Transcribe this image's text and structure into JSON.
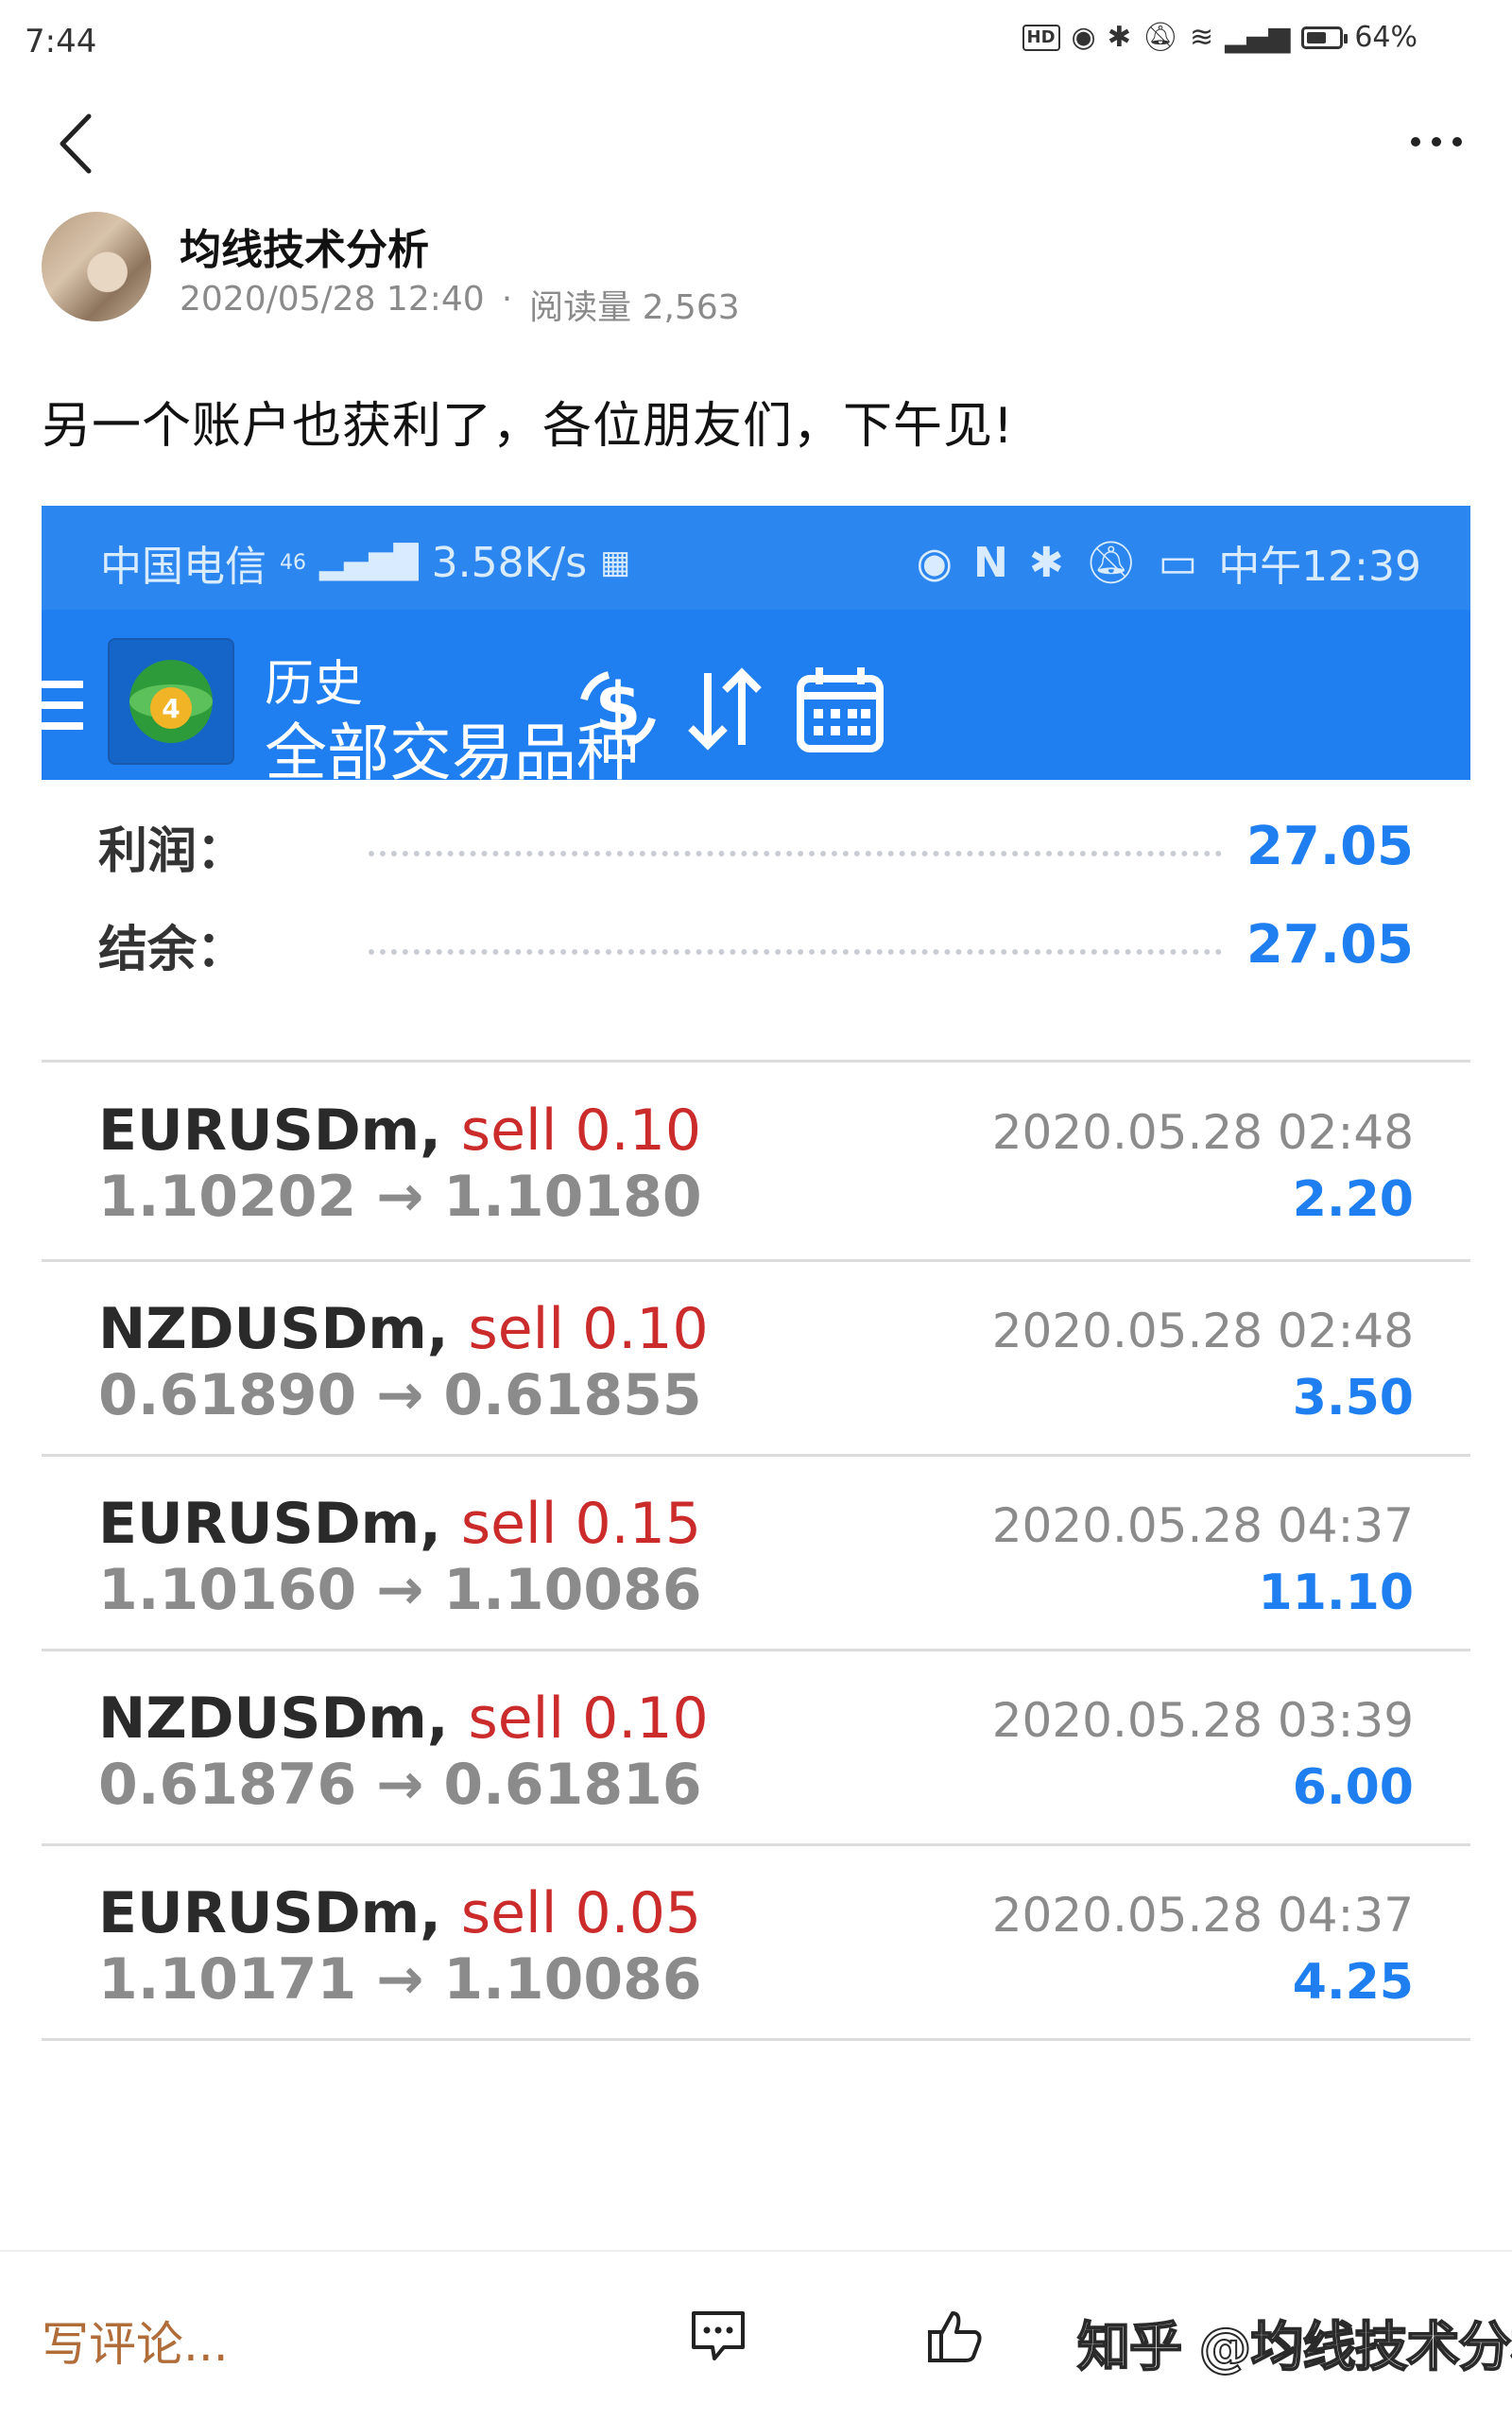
{
  "status_bar": {
    "time": "7:44",
    "hd": "HD",
    "battery": "64%",
    "battery_level": 0.64
  },
  "article": {
    "author": "均线技术分析",
    "date": "2020/05/28 12:40",
    "separator": "·",
    "views_label": "阅读量 2,563",
    "text": "另一个账户也获利了，各位朋友们，下午见!"
  },
  "embedded": {
    "status": {
      "carrier": "中国电信",
      "network": "46",
      "speed": "3.58K/s",
      "time": "中午12:39"
    },
    "appbar": {
      "title": "历史",
      "subtitle": "全部交易品种",
      "logo_number": "4"
    },
    "summary": [
      {
        "label": "利润：",
        "value": "27.05"
      },
      {
        "label": "结余：",
        "value": "27.05"
      }
    ],
    "trades": [
      {
        "symbol": "EURUSDm",
        "action": "sell 0.10",
        "open": "1.10202",
        "close": "1.10180",
        "time": "2020.05.28 02:48",
        "profit": "2.20"
      },
      {
        "symbol": "NZDUSDm",
        "action": "sell 0.10",
        "open": "0.61890",
        "close": "0.61855",
        "time": "2020.05.28 02:48",
        "profit": "3.50"
      },
      {
        "symbol": "EURUSDm",
        "action": "sell 0.15",
        "open": "1.10160",
        "close": "1.10086",
        "time": "2020.05.28 04:37",
        "profit": "11.10"
      },
      {
        "symbol": "NZDUSDm",
        "action": "sell 0.10",
        "open": "0.61876",
        "close": "0.61816",
        "time": "2020.05.28 03:39",
        "profit": "6.00"
      },
      {
        "symbol": "EURUSDm",
        "action": "sell 0.05",
        "open": "1.10171",
        "close": "1.10086",
        "time": "2020.05.28 04:37",
        "profit": "4.25"
      }
    ]
  },
  "bottom_bar": {
    "comment_placeholder": "写评论...",
    "watermark": "知乎 @均线技术分析"
  },
  "colors": {
    "accent_blue": "#1f7ff0",
    "sell_red": "#cc2b2b",
    "comment_brown": "#b06d3a"
  }
}
